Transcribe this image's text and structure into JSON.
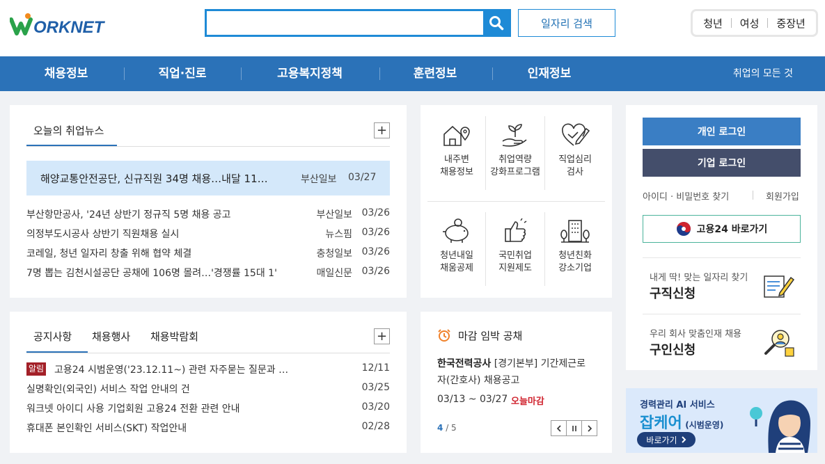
{
  "header": {
    "logo_text": "WORKNET",
    "search_placeholder": "",
    "job_search_label": "일자리 검색",
    "user_types": [
      "청년",
      "여성",
      "중장년"
    ]
  },
  "nav": {
    "items": [
      "채용정보",
      "직업·진로",
      "고용복지정책",
      "훈련정보",
      "인재정보"
    ],
    "all_label": "취업의 모든 것"
  },
  "news": {
    "tab_label": "오늘의 취업뉴스",
    "plus": "+",
    "headline": {
      "title": "해양교통안전공단, 신규직원 34명 채용…내달 11…",
      "source": "부산일보",
      "date": "03/27"
    },
    "items": [
      {
        "title": "부산항만공사, '24년 상반기 정규직 5명 채용 공고",
        "source": "부산일보",
        "date": "03/26"
      },
      {
        "title": "의정부도시공사 상반기 직원채용 실시",
        "source": "뉴스핌",
        "date": "03/26"
      },
      {
        "title": "코레일, 청년 일자리 창출 위해 협약 체결",
        "source": "충청일보",
        "date": "03/26"
      },
      {
        "title": "7명 뽑는 김천시설공단 공채에 106명 몰려…'경쟁률 15대 1'",
        "source": "매일신문",
        "date": "03/26"
      }
    ]
  },
  "services": [
    {
      "icon": "house-map-pin-icon",
      "line1": "내주변",
      "line2": "채용정보"
    },
    {
      "icon": "hand-sprout-icon",
      "line1": "취업역량",
      "line2": "강화프로그램"
    },
    {
      "icon": "heart-pencil-icon",
      "line1": "직업심리",
      "line2": "검사"
    },
    {
      "icon": "piggy-bank-icon",
      "line1": "청년내일",
      "line2": "채움공제"
    },
    {
      "icon": "thumbs-up-icon",
      "line1": "국민취업",
      "line2": "지원제도"
    },
    {
      "icon": "building-trees-icon",
      "line1": "청년친화",
      "line2": "강소기업"
    }
  ],
  "login": {
    "personal_label": "개인 로그인",
    "company_label": "기업 로그인",
    "find_label": "아이디 · 비밀번호 찾기",
    "join_label": "회원가입",
    "gov24_label": "고용24 바로가기",
    "job_seek": {
      "sub": "내게 딱! 맞는 일자리 찾기",
      "title": "구직신청"
    },
    "recruit": {
      "sub": "우리 회사 맞춤인재 채용",
      "title": "구인신청"
    }
  },
  "notice": {
    "tabs": [
      "공지사항",
      "채용행사",
      "채용박람회"
    ],
    "plus": "+",
    "badge": "알림",
    "items": [
      {
        "title": "고용24 시범운영('23.12.11~) 관련 자주묻는 질문과 …",
        "date": "12/11"
      },
      {
        "title": "실명확인(외국인) 서비스 작업 안내의 건",
        "date": "03/25"
      },
      {
        "title": "워크넷 아이디 사용 기업회원 고용24 전환 관련 안내",
        "date": "03/20"
      },
      {
        "title": "휴대폰 본인확인 서비스(SKT) 작업안내",
        "date": "02/28"
      }
    ]
  },
  "deadline": {
    "title": "마감 임박 공채",
    "company": "한국전력공사",
    "desc1": "[경기본부] 기간제근로",
    "desc2": "자(간호사) 채용공고",
    "period": "03/13 ~ 03/27",
    "status": "오늘마감",
    "page_current": "4",
    "page_total": "/ 5"
  },
  "banner": {
    "line1": "경력관리 AI 서비스",
    "brand": "잡케어",
    "note": "(시범운영)",
    "button": "바로가기"
  },
  "colors": {
    "primary": "#2b72b8",
    "search_border": "#1e8ad6",
    "personal_login": "#3a7ec4",
    "company_login": "#444e6b",
    "headline_bg": "#d4e8fa",
    "badge": "#a32028",
    "deadline_status": "#d0242f"
  }
}
